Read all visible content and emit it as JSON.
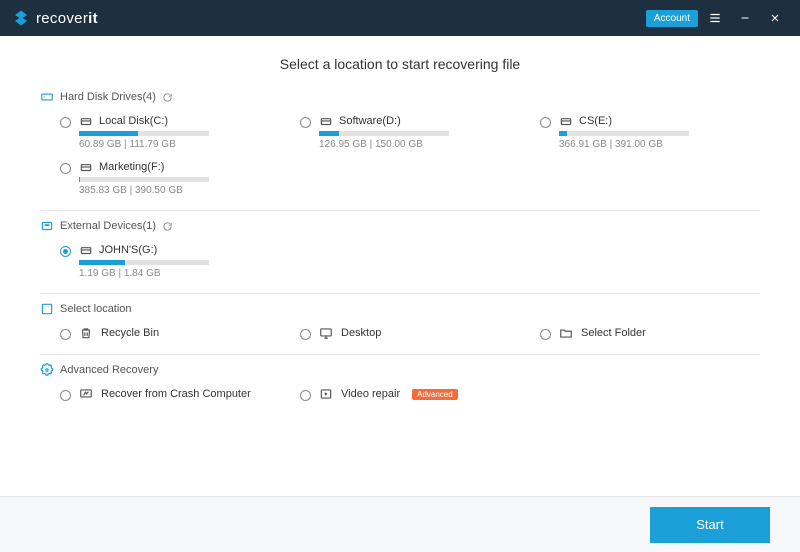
{
  "brand": {
    "pre": "recover",
    "post": "it"
  },
  "titlebar": {
    "account": "Account"
  },
  "page_title": "Select a location to start recovering file",
  "sections": {
    "hdd": {
      "label": "Hard Disk Drives(4)"
    },
    "ext": {
      "label": "External Devices(1)"
    },
    "loc": {
      "label": "Select location"
    },
    "adv": {
      "label": "Advanced Recovery"
    }
  },
  "hdd_drives": [
    {
      "name": "Local Disk(C:)",
      "size": "60.89  GB | 111.79  GB",
      "pct": 45
    },
    {
      "name": "Software(D:)",
      "size": "126.95  GB | 150.00  GB",
      "pct": 15
    },
    {
      "name": "CS(E:)",
      "size": "366.91  GB | 391.00  GB",
      "pct": 6
    },
    {
      "name": "Marketing(F:)",
      "size": "385.83  GB | 390.50  GB",
      "pct": 1
    }
  ],
  "ext_drives": [
    {
      "name": "JOHN'S(G:)",
      "size": "1.19  GB | 1.84  GB",
      "pct": 35,
      "selected": true
    }
  ],
  "locations": [
    {
      "name": "Recycle Bin",
      "icon": "recycle"
    },
    {
      "name": "Desktop",
      "icon": "desktop"
    },
    {
      "name": "Select Folder",
      "icon": "folder"
    }
  ],
  "advanced": [
    {
      "name": "Recover from Crash Computer",
      "icon": "crash",
      "badge": null
    },
    {
      "name": "Video repair",
      "icon": "video",
      "badge": "Advanced"
    }
  ],
  "footer": {
    "start": "Start"
  }
}
